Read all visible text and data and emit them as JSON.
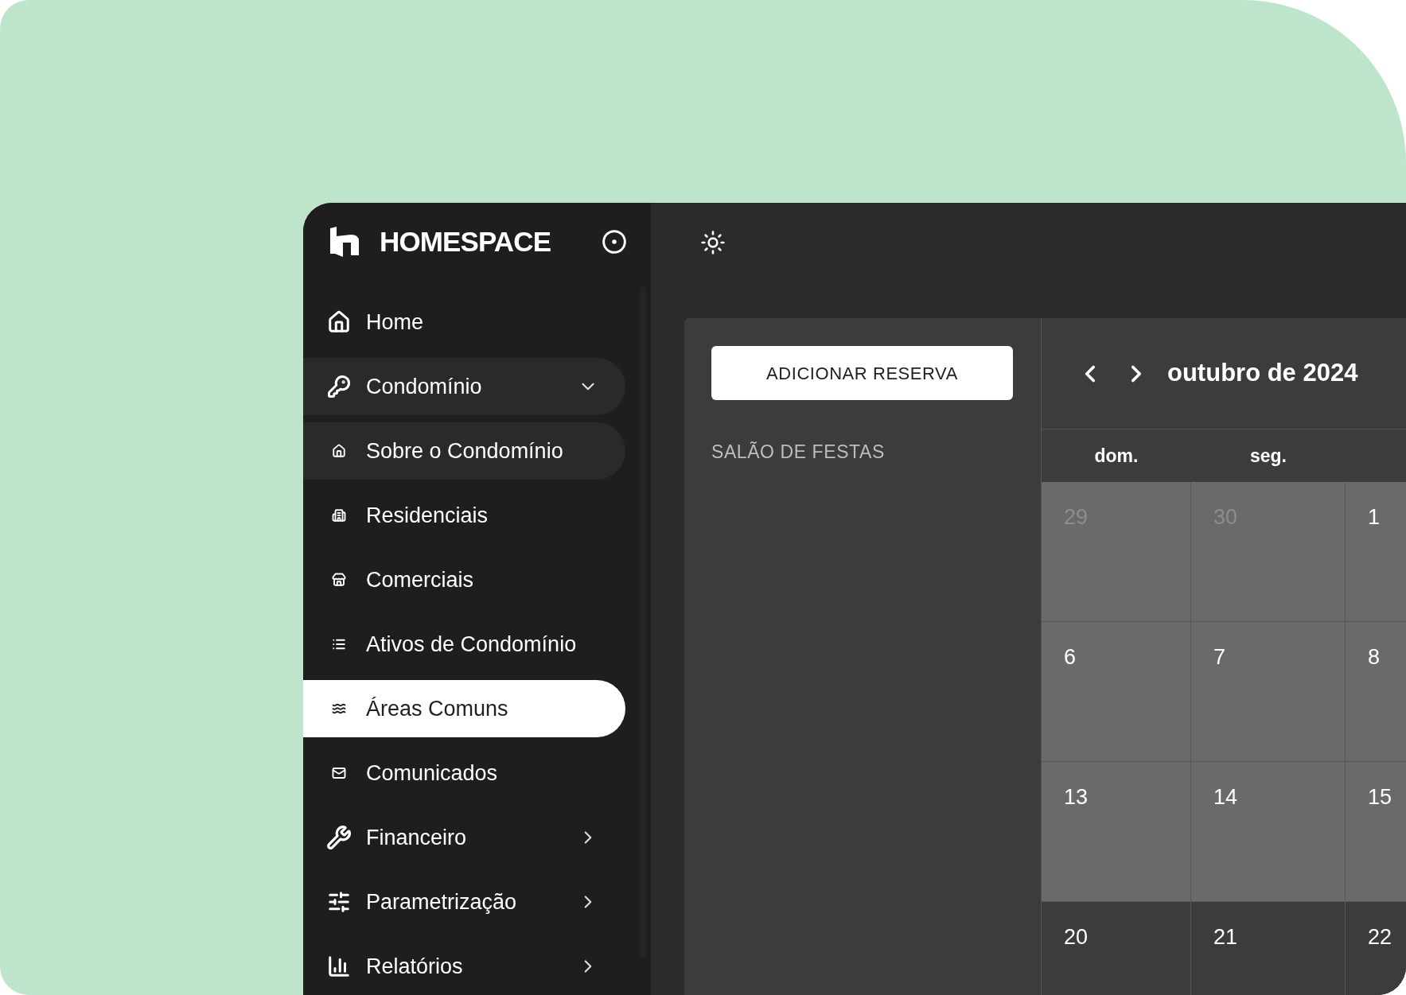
{
  "sidebar": {
    "brand": "HOMESPACE",
    "items": [
      {
        "label": "Home",
        "kind": "link",
        "selected": false,
        "highlighted": false
      },
      {
        "label": "Condomínio",
        "kind": "group",
        "expanded": true,
        "selected": false,
        "highlighted": true
      },
      {
        "label": "Sobre o Condomínio",
        "kind": "sub",
        "selected": false,
        "highlighted": true
      },
      {
        "label": "Residenciais",
        "kind": "sub",
        "selected": false,
        "highlighted": false
      },
      {
        "label": "Comerciais",
        "kind": "sub",
        "selected": false,
        "highlighted": false
      },
      {
        "label": "Ativos de Condomínio",
        "kind": "sub",
        "selected": false,
        "highlighted": false
      },
      {
        "label": "Áreas Comuns",
        "kind": "sub",
        "selected": true,
        "highlighted": false
      },
      {
        "label": "Comunicados",
        "kind": "sub",
        "selected": false,
        "highlighted": false
      },
      {
        "label": "Financeiro",
        "kind": "group",
        "expanded": false,
        "selected": false,
        "highlighted": false
      },
      {
        "label": "Parametrização",
        "kind": "group",
        "expanded": false,
        "selected": false,
        "highlighted": false
      },
      {
        "label": "Relatórios",
        "kind": "group",
        "expanded": false,
        "selected": false,
        "highlighted": false
      }
    ]
  },
  "panel": {
    "add_button": "ADICIONAR RESERVA",
    "areas": [
      "SALÃO DE FESTAS"
    ]
  },
  "calendar": {
    "month": "outubro de 2024",
    "weekdays": [
      "dom.",
      "seg."
    ],
    "weeks": [
      [
        {
          "day": "29",
          "outside": true,
          "shaded": true
        },
        {
          "day": "30",
          "outside": true,
          "shaded": true
        },
        {
          "day": "1",
          "outside": false,
          "shaded": true
        }
      ],
      [
        {
          "day": "6",
          "outside": false,
          "shaded": true
        },
        {
          "day": "7",
          "outside": false,
          "shaded": true
        },
        {
          "day": "8",
          "outside": false,
          "shaded": true
        }
      ],
      [
        {
          "day": "13",
          "outside": false,
          "shaded": true
        },
        {
          "day": "14",
          "outside": false,
          "shaded": true
        },
        {
          "day": "15",
          "outside": false,
          "shaded": true
        }
      ],
      [
        {
          "day": "20",
          "outside": false,
          "shaded": false
        },
        {
          "day": "21",
          "outside": false,
          "shaded": false
        },
        {
          "day": "22",
          "outside": false,
          "shaded": false
        }
      ]
    ]
  }
}
